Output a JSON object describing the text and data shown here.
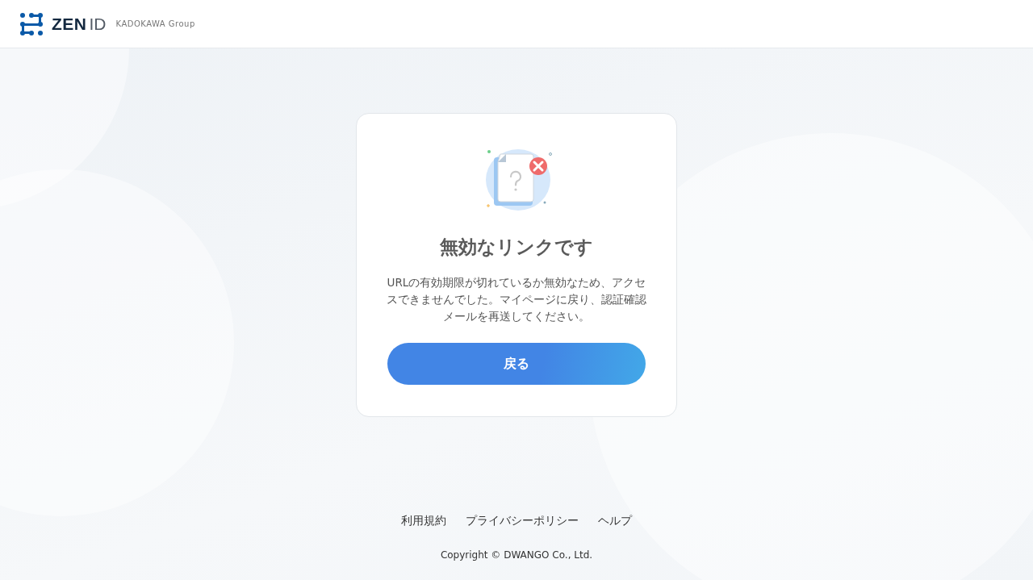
{
  "header": {
    "logo_primary": "ZEN",
    "logo_secondary": "ID",
    "group": "KADOKAWA Group"
  },
  "card": {
    "title": "無効なリンクです",
    "message": "URLの有効期限が切れているか無効なため、アクセスできませんでした。マイページに戻り、認証確認メールを再送してください。",
    "button": "戻る"
  },
  "footer": {
    "links": [
      "利用規約",
      "プライバシーポリシー",
      "ヘルプ"
    ],
    "copyright": "Copyright © DWANGO Co., Ltd."
  }
}
